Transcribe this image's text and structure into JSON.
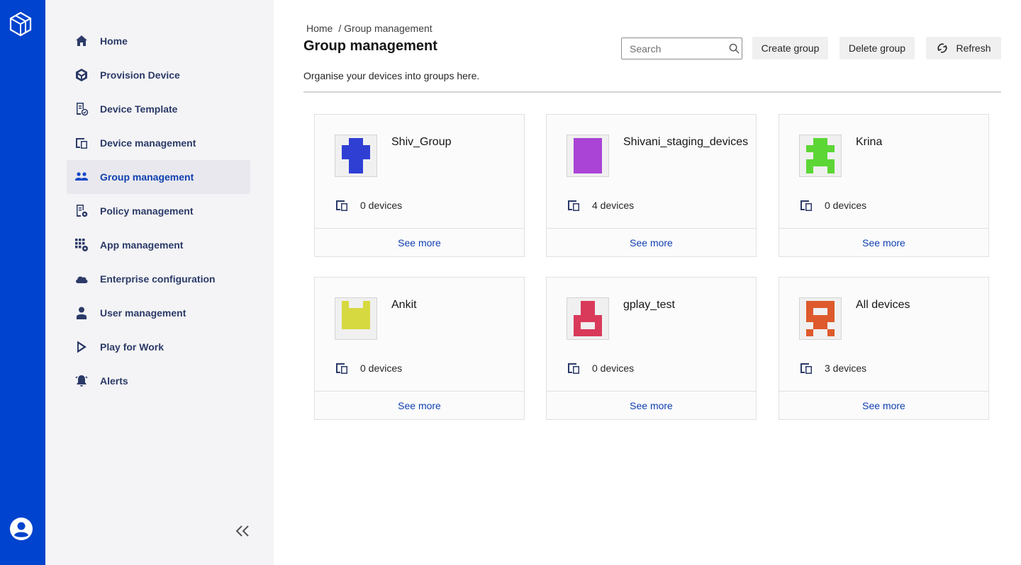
{
  "sidebar": {
    "items": [
      {
        "label": "Home",
        "icon": "home-icon"
      },
      {
        "label": "Provision Device",
        "icon": "provision-device-icon"
      },
      {
        "label": "Device Template",
        "icon": "device-template-icon"
      },
      {
        "label": "Device management",
        "icon": "device-management-icon"
      },
      {
        "label": "Group management",
        "icon": "group-icon",
        "active": true
      },
      {
        "label": "Policy management",
        "icon": "policy-icon"
      },
      {
        "label": "App management",
        "icon": "app-management-icon"
      },
      {
        "label": "Enterprise configuration",
        "icon": "cloud-icon"
      },
      {
        "label": "User management",
        "icon": "user-icon"
      },
      {
        "label": "Play for Work",
        "icon": "play-icon"
      },
      {
        "label": "Alerts",
        "icon": "bell-icon"
      }
    ]
  },
  "breadcrumb": {
    "home": "Home",
    "current": "/ Group management"
  },
  "page": {
    "title": "Group management",
    "description": "Organise your devices into groups here."
  },
  "search": {
    "placeholder": "Search"
  },
  "toolbar": {
    "create_label": "Create group",
    "delete_label": "Delete group",
    "refresh_label": "Refresh"
  },
  "groups": [
    {
      "name": "Shiv_Group",
      "devices": "0 devices",
      "link": "See more",
      "color": "#2f3fd4"
    },
    {
      "name": "Shivani_staging_devices",
      "devices": "4 devices",
      "link": "See more",
      "color": "#a944d6"
    },
    {
      "name": "Krina",
      "devices": "0 devices",
      "link": "See more",
      "color": "#5cd635"
    },
    {
      "name": "Ankit",
      "devices": "0 devices",
      "link": "See more",
      "color": "#d6d93f"
    },
    {
      "name": "gplay_test",
      "devices": "0 devices",
      "link": "See more",
      "color": "#d93a5a"
    },
    {
      "name": "All devices",
      "devices": "3 devices",
      "link": "See more",
      "color": "#de5a2c"
    }
  ],
  "colors": {
    "rail": "#0043ce",
    "accent": "#0f3fb0",
    "nav_text": "#2b3a67"
  }
}
